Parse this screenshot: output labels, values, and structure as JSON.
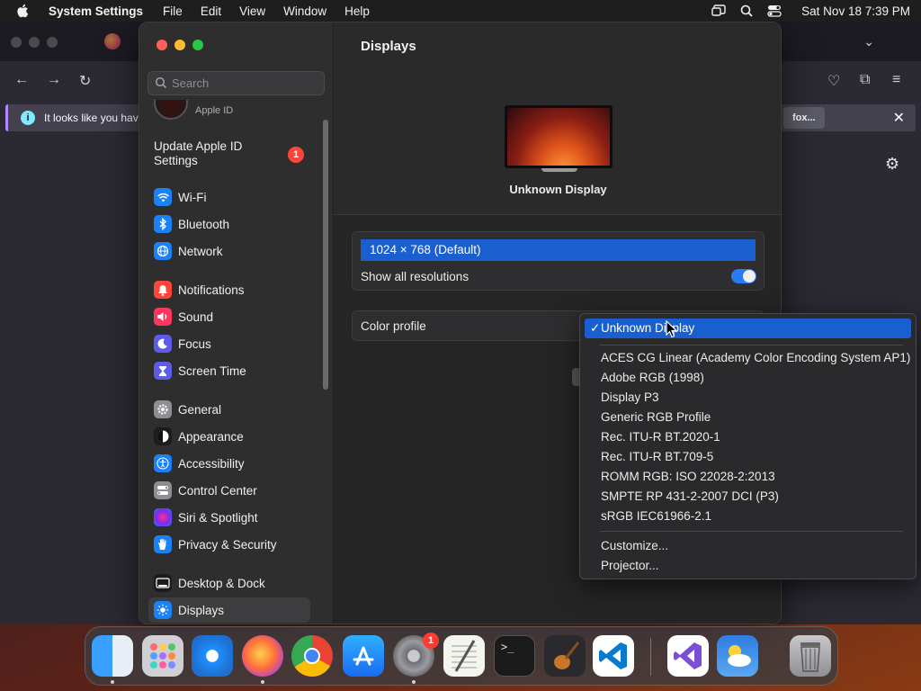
{
  "menubar": {
    "app_name": "System Settings",
    "menus": [
      "File",
      "Edit",
      "View",
      "Window",
      "Help"
    ],
    "clock": "Sat Nov 18  7:39 PM"
  },
  "browser": {
    "notice_text": "It looks like you have",
    "notice_button": "fox..."
  },
  "sidebar": {
    "search_placeholder": "Search",
    "apple_id_label": "Apple ID",
    "update_label": "Update Apple ID Settings",
    "update_badge": "1",
    "items": [
      {
        "label": "Wi-Fi",
        "icon": "wifi-icon",
        "color": "#1a82f6"
      },
      {
        "label": "Bluetooth",
        "icon": "bluetooth-icon",
        "color": "#1a82f6"
      },
      {
        "label": "Network",
        "icon": "globe-icon",
        "color": "#1a82f6"
      },
      {
        "label": "Notifications",
        "icon": "bell-icon",
        "color": "#ff453a"
      },
      {
        "label": "Sound",
        "icon": "speaker-icon",
        "color": "#ff375f"
      },
      {
        "label": "Focus",
        "icon": "moon-icon",
        "color": "#5e5ce6"
      },
      {
        "label": "Screen Time",
        "icon": "hourglass-icon",
        "color": "#5e5ce6"
      },
      {
        "label": "General",
        "icon": "gear-icon",
        "color": "#8e8e93"
      },
      {
        "label": "Appearance",
        "icon": "appearance-icon",
        "color": "#1c1c1e"
      },
      {
        "label": "Accessibility",
        "icon": "accessibility-icon",
        "color": "#1a82f6"
      },
      {
        "label": "Control Center",
        "icon": "control-center-icon",
        "color": "#8e8e93"
      },
      {
        "label": "Siri & Spotlight",
        "icon": "siri-icon",
        "color": "#bf5af2"
      },
      {
        "label": "Privacy & Security",
        "icon": "hand-icon",
        "color": "#1a82f6"
      },
      {
        "label": "Desktop & Dock",
        "icon": "dock-icon",
        "color": "#1c1c1e"
      },
      {
        "label": "Displays",
        "icon": "sun-icon",
        "color": "#1a82f6"
      }
    ]
  },
  "main": {
    "title": "Displays",
    "display_name": "Unknown Display",
    "resolution": "1024 × 768 (Default)",
    "show_all_label": "Show all resolutions",
    "color_profile_label": "Color profile"
  },
  "popup": {
    "selected": "Unknown Display",
    "check": "✓",
    "group1": [
      "ACES CG Linear (Academy Color Encoding System AP1)",
      "Adobe RGB (1998)",
      "Display P3",
      "Generic RGB Profile",
      "Rec. ITU-R BT.2020-1",
      "Rec. ITU-R BT.709-5",
      "ROMM RGB: ISO 22028-2:2013",
      "SMPTE RP 431-2-2007 DCI (P3)",
      "sRGB IEC61966-2.1"
    ],
    "group2": [
      "Customize...",
      "Projector..."
    ]
  },
  "dock": {
    "apps": [
      {
        "name": "finder-icon",
        "color": "#2f8cf0"
      },
      {
        "name": "launchpad-icon",
        "color": "#d9d9de"
      },
      {
        "name": "safari-icon",
        "color": "#1e90ff"
      },
      {
        "name": "firefox-icon",
        "color": "#ff7139"
      },
      {
        "name": "chrome-icon",
        "color": "#e8e8e8"
      },
      {
        "name": "app-store-icon",
        "color": "#1a8cff"
      },
      {
        "name": "system-settings-icon",
        "color": "#8a8a8e"
      },
      {
        "name": "textedit-icon",
        "color": "#f5f5f0"
      },
      {
        "name": "terminal-icon",
        "color": "#1a1a1a"
      },
      {
        "name": "garageband-icon",
        "color": "#2a2a2e"
      },
      {
        "name": "vscode-icon",
        "color": "#ffffff"
      },
      {
        "name": "visual-studio-icon",
        "color": "#ffffff"
      },
      {
        "name": "weather-icon",
        "color": "#2f7de0"
      },
      {
        "name": "trash-icon",
        "color": "#8e8e93"
      }
    ],
    "settings_badge": "1",
    "terminal_prompt": ">_"
  }
}
